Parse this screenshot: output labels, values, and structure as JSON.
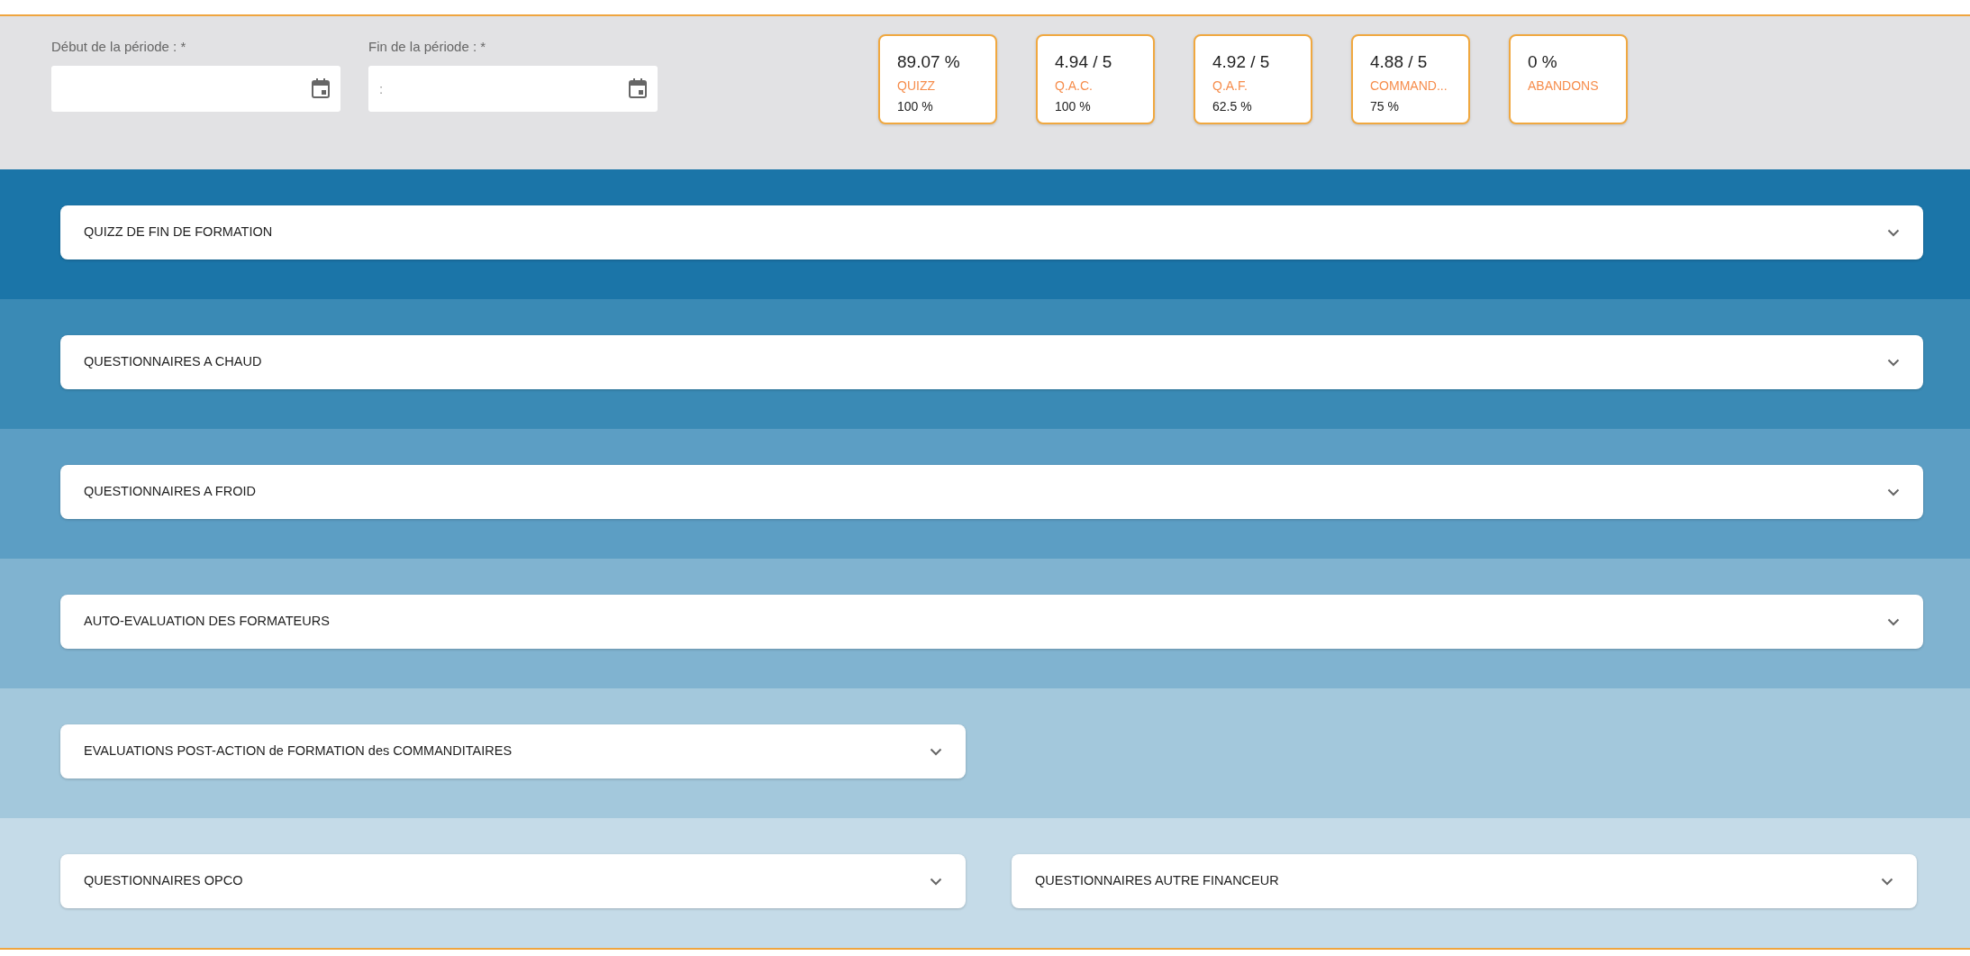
{
  "period_fields": [
    {
      "label": "Début de la période : *"
    },
    {
      "label": "Fin de la période : *",
      "placeholder": ":"
    }
  ],
  "stat_cards": [
    {
      "value": "89.07 %",
      "label": "QUIZZ",
      "sub": "100 %"
    },
    {
      "value": "4.94 / 5",
      "label": "Q.A.C.",
      "sub": "100 %"
    },
    {
      "value": "4.92 / 5",
      "label": "Q.A.F.",
      "sub": "62.5 %"
    },
    {
      "value": "4.88 / 5",
      "label": "COMMAND...",
      "sub": "75 %"
    },
    {
      "value": "0 %",
      "label": "ABANDONS"
    }
  ],
  "sections": [
    {
      "panels": [
        {
          "title": "QUIZZ DE FIN DE FORMATION",
          "expanded": false,
          "wide": true
        }
      ]
    },
    {
      "panels": [
        {
          "title": "QUESTIONNAIRES A CHAUD",
          "expanded": false,
          "wide": true
        }
      ]
    },
    {
      "panels": [
        {
          "title": "QUESTIONNAIRES A FROID",
          "expanded": false,
          "wide": true
        }
      ]
    },
    {
      "panels": [
        {
          "title": "AUTO-EVALUATION DES FORMATEURS",
          "expanded": false,
          "wide": true
        }
      ]
    },
    {
      "panels": [
        {
          "title": "EVALUATIONS POST-ACTION de FORMATION des COMMANDITAIRES",
          "expanded": false,
          "wide": false
        }
      ]
    },
    {
      "panels": [
        {
          "title": "QUESTIONNAIRES OPCO",
          "expanded": false,
          "wide": false
        },
        {
          "title": "QUESTIONNAIRES AUTRE FINANCEUR",
          "expanded": false,
          "wide": false
        }
      ]
    }
  ]
}
